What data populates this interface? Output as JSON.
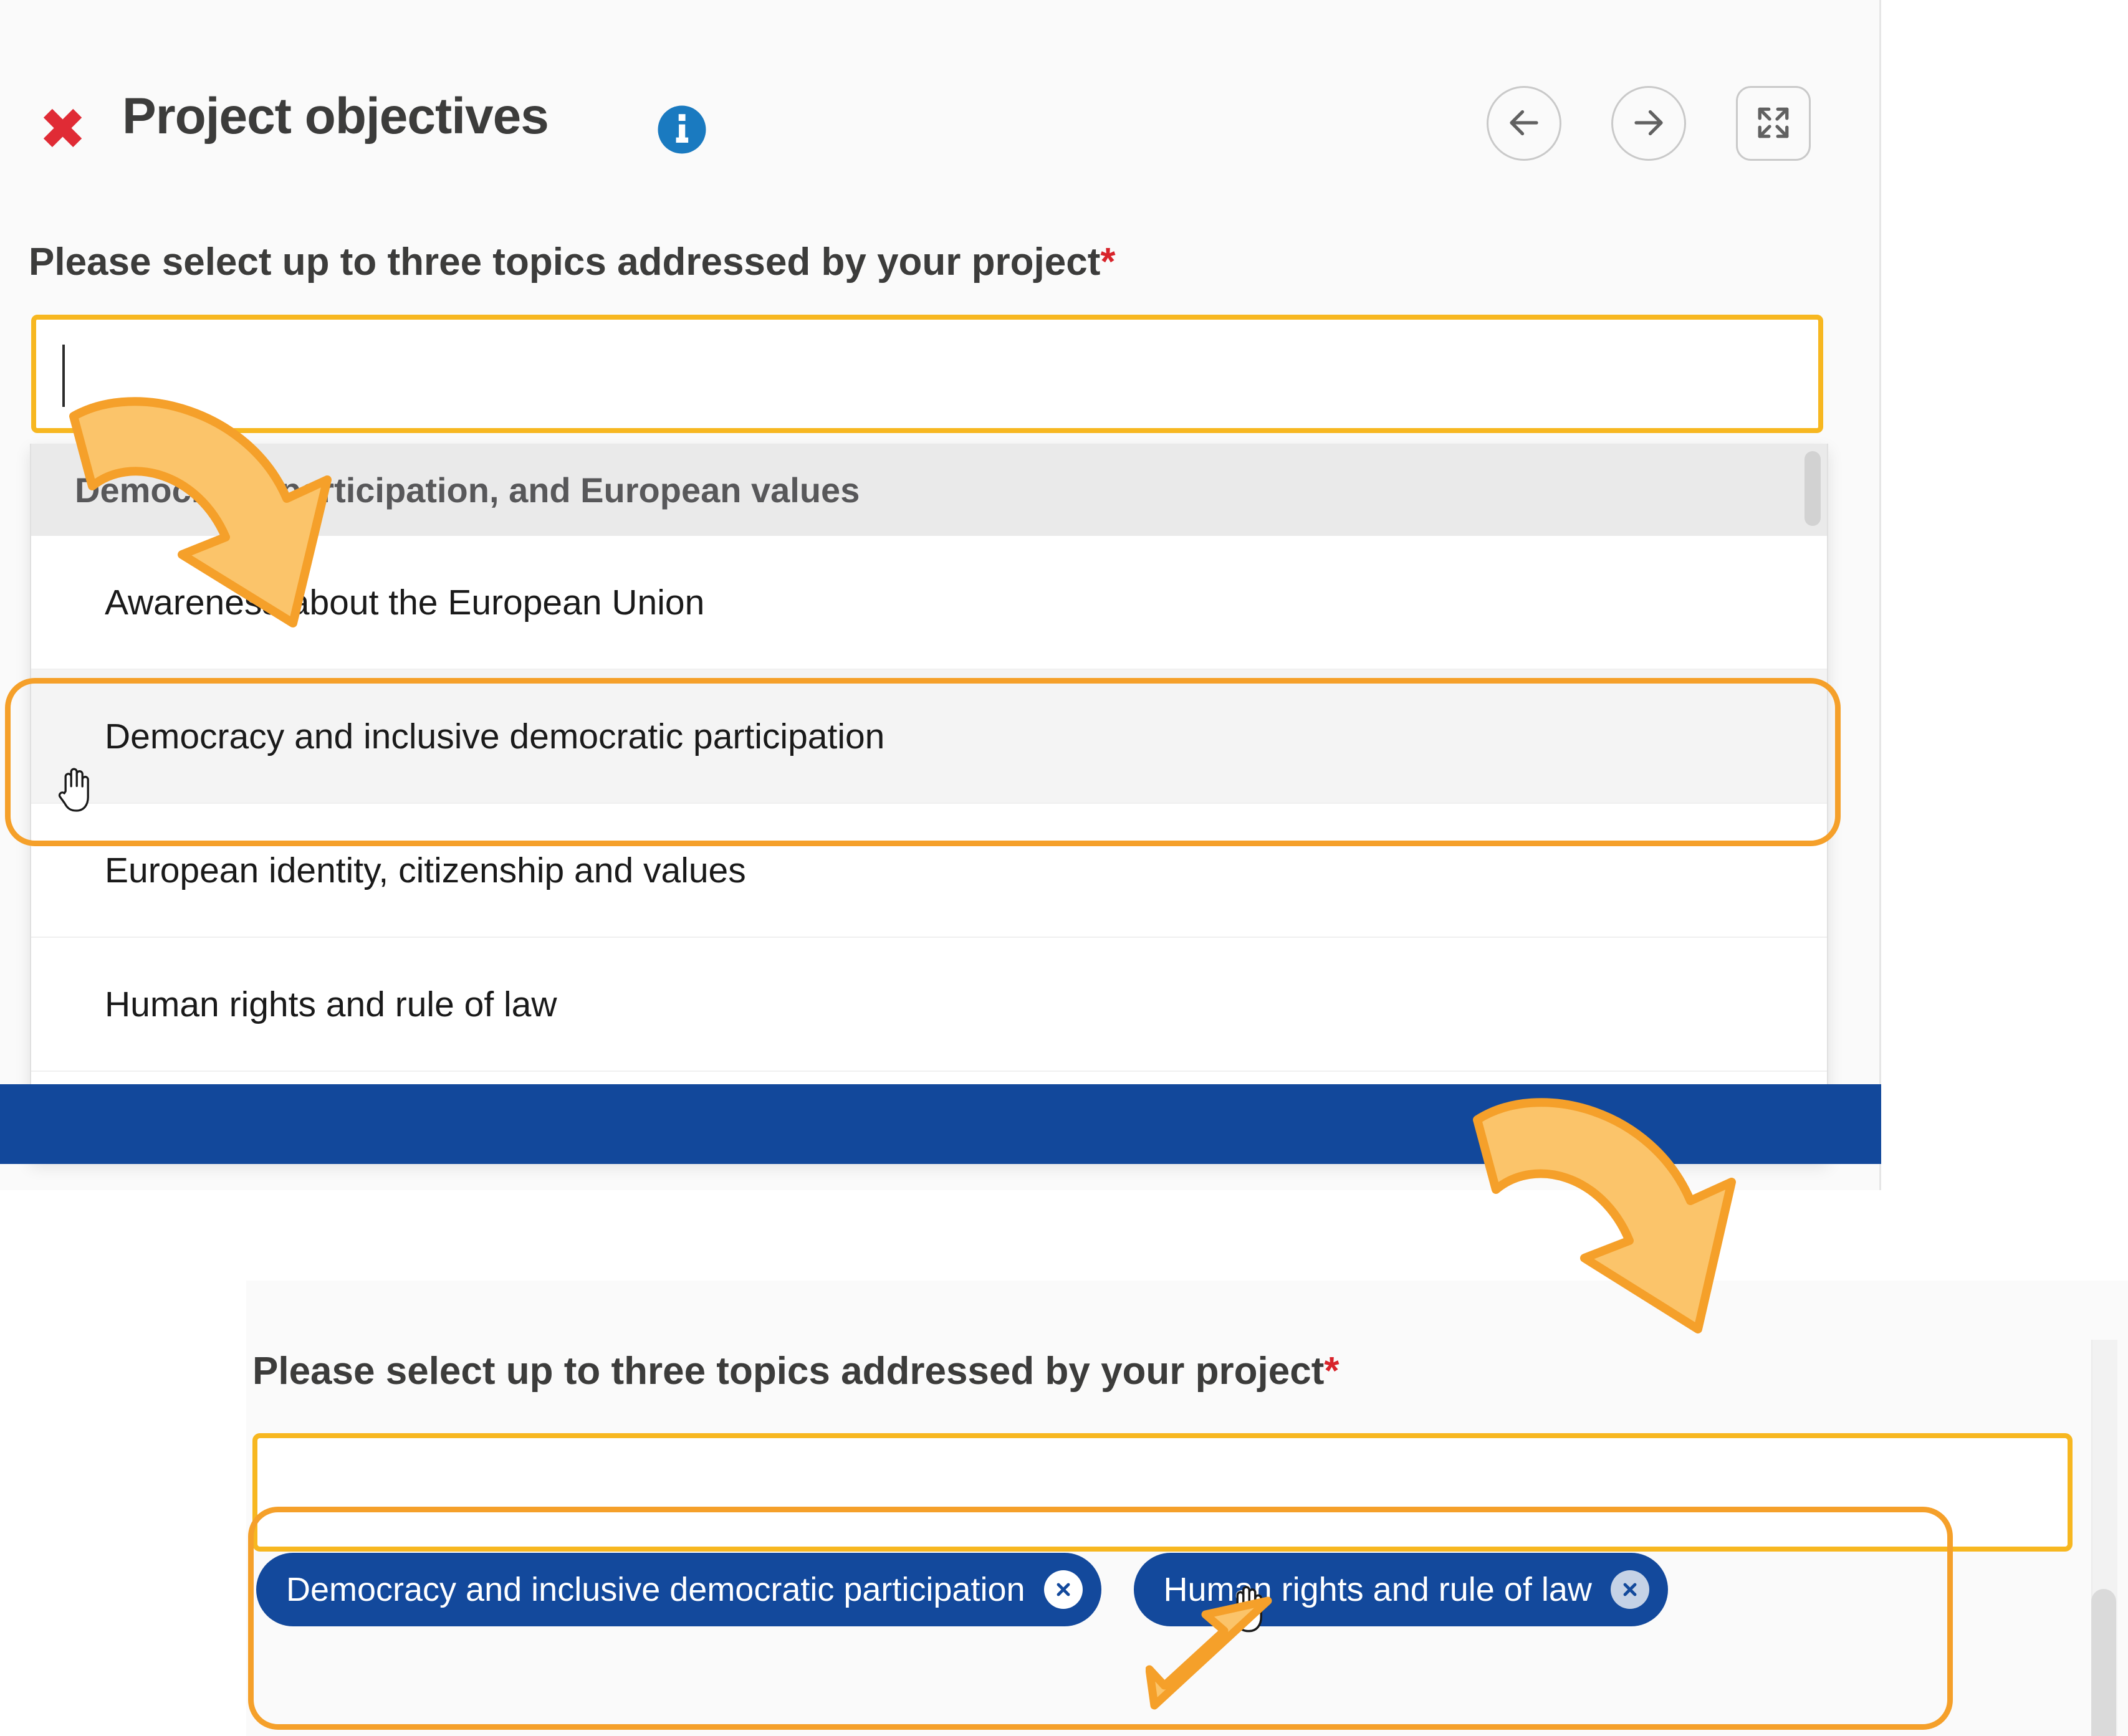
{
  "dialog": {
    "title": "Project objectives",
    "close_icon": "close-x-icon",
    "info_icon": "info-circle-icon",
    "nav": {
      "back_icon": "arrow-left-icon",
      "forward_icon": "arrow-right-icon",
      "fullscreen_icon": "expand-fullscreen-icon"
    }
  },
  "form": {
    "question_label": "Please select up to three topics addressed by your project",
    "required_marker": "*",
    "input_value": "",
    "input_placeholder": ""
  },
  "dropdown": {
    "group_header": "Democracy, participation, and European values",
    "options": [
      {
        "label": "Awareness about the European Union",
        "highlighted": false
      },
      {
        "label": "Democracy and inclusive democratic participation",
        "highlighted": true
      },
      {
        "label": "European identity, citizenship and values",
        "highlighted": false
      },
      {
        "label": "Human rights and rule of law",
        "highlighted": false
      }
    ]
  },
  "bottom": {
    "question_label": "Please select up to three topics addressed by your project",
    "required_marker": "*",
    "input_value": "",
    "chips": [
      {
        "label": "Democracy and inclusive democratic participation",
        "remove_icon": "close-circle-icon",
        "remove_style": "light"
      },
      {
        "label": "Human rights and rule of law",
        "remove_icon": "close-circle-icon",
        "remove_style": "faded"
      }
    ]
  },
  "annotations": {
    "highlight_color": "#f5a02a",
    "focus_ring_color": "#f7b720",
    "arrows": [
      {
        "name": "arrow-input-to-option",
        "direction": "down-right"
      },
      {
        "name": "arrow-dropdown-to-chips",
        "direction": "down-right"
      },
      {
        "name": "arrow-pointing-chip-remove",
        "direction": "up-right"
      }
    ]
  },
  "colors": {
    "chip_blue": "#13499c",
    "footer_blue": "#12489b",
    "close_red": "#e02b35",
    "required_red": "#d8232a",
    "info_blue": "#1a7ac0",
    "panel_bg": "#fafafa"
  }
}
